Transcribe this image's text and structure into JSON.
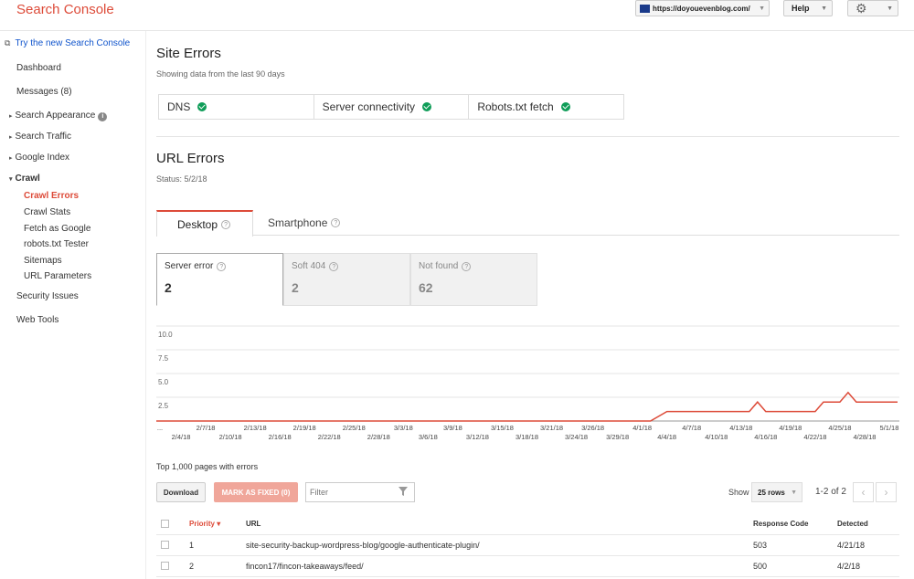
{
  "header": {
    "app_title": "Search Console",
    "site_url": "https://doyouevenblog.com/",
    "help_label": "Help"
  },
  "sidebar": {
    "new_console_link": "Try the new Search Console",
    "items": [
      {
        "label": "Dashboard"
      },
      {
        "label": "Messages (8)"
      },
      {
        "label": "Search Appearance"
      },
      {
        "label": "Search Traffic"
      },
      {
        "label": "Google Index"
      },
      {
        "label": "Crawl"
      },
      {
        "label": "Security Issues"
      },
      {
        "label": "Web Tools"
      }
    ],
    "crawl_sub": [
      {
        "label": "Crawl Errors"
      },
      {
        "label": "Crawl Stats"
      },
      {
        "label": "Fetch as Google"
      },
      {
        "label": "robots.txt Tester"
      },
      {
        "label": "Sitemaps"
      },
      {
        "label": "URL Parameters"
      }
    ]
  },
  "site_errors": {
    "title": "Site Errors",
    "subtitle": "Showing data from the last 90 days",
    "cells": [
      {
        "label": "DNS"
      },
      {
        "label": "Server connectivity"
      },
      {
        "label": "Robots.txt fetch"
      }
    ]
  },
  "url_errors": {
    "title": "URL Errors",
    "status": "Status: 5/2/18",
    "tabs": [
      {
        "label": "Desktop"
      },
      {
        "label": "Smartphone"
      }
    ],
    "stats": [
      {
        "label": "Server error",
        "value": "2"
      },
      {
        "label": "Soft 404",
        "value": "2"
      },
      {
        "label": "Not found",
        "value": "62"
      }
    ]
  },
  "chart_data": {
    "type": "line",
    "ylim": [
      0,
      10
    ],
    "y_ticks": [
      "10.0",
      "7.5",
      "5.0",
      "2.5"
    ],
    "x_ticks_top": [
      "...",
      "2/7/18",
      "2/13/18",
      "2/19/18",
      "2/25/18",
      "3/3/18",
      "3/9/18",
      "3/15/18",
      "3/21/18",
      "3/26/18",
      "4/1/18",
      "4/7/18",
      "4/13/18",
      "4/19/18",
      "4/25/18",
      "5/1/18"
    ],
    "x_ticks_bottom": [
      "2/4/18",
      "2/10/18",
      "2/16/18",
      "2/22/18",
      "2/28/18",
      "3/6/18",
      "3/12/18",
      "3/18/18",
      "3/24/18",
      "3/29/18",
      "4/4/18",
      "4/10/18",
      "4/16/18",
      "4/22/18",
      "4/28/18"
    ],
    "series": [
      {
        "color": "#dd4b39",
        "points": [
          [
            "2/1/18",
            0
          ],
          [
            "4/2/18",
            0
          ],
          [
            "4/4/18",
            1
          ],
          [
            "4/14/18",
            1
          ],
          [
            "4/15/18",
            2
          ],
          [
            "4/16/18",
            1
          ],
          [
            "4/22/18",
            1
          ],
          [
            "4/23/18",
            2
          ],
          [
            "4/25/18",
            2
          ],
          [
            "4/26/18",
            3
          ],
          [
            "4/27/18",
            2
          ],
          [
            "5/2/18",
            2
          ]
        ]
      }
    ]
  },
  "table": {
    "caption": "Top 1,000 pages with errors",
    "download_label": "Download",
    "mark_fixed_label": "MARK AS FIXED (0)",
    "filter_placeholder": "Filter",
    "show_label": "Show",
    "rows_option": "25 rows",
    "range": "1-2 of 2",
    "columns": {
      "priority": "Priority",
      "url": "URL",
      "response_code": "Response Code",
      "detected": "Detected"
    },
    "rows": [
      {
        "priority": "1",
        "url": "site-security-backup-wordpress-blog/google-authenticate-plugin/",
        "response_code": "503",
        "detected": "4/21/18"
      },
      {
        "priority": "2",
        "url": "fincon17/fincon-takeaways/feed/",
        "response_code": "500",
        "detected": "4/2/18"
      }
    ]
  }
}
